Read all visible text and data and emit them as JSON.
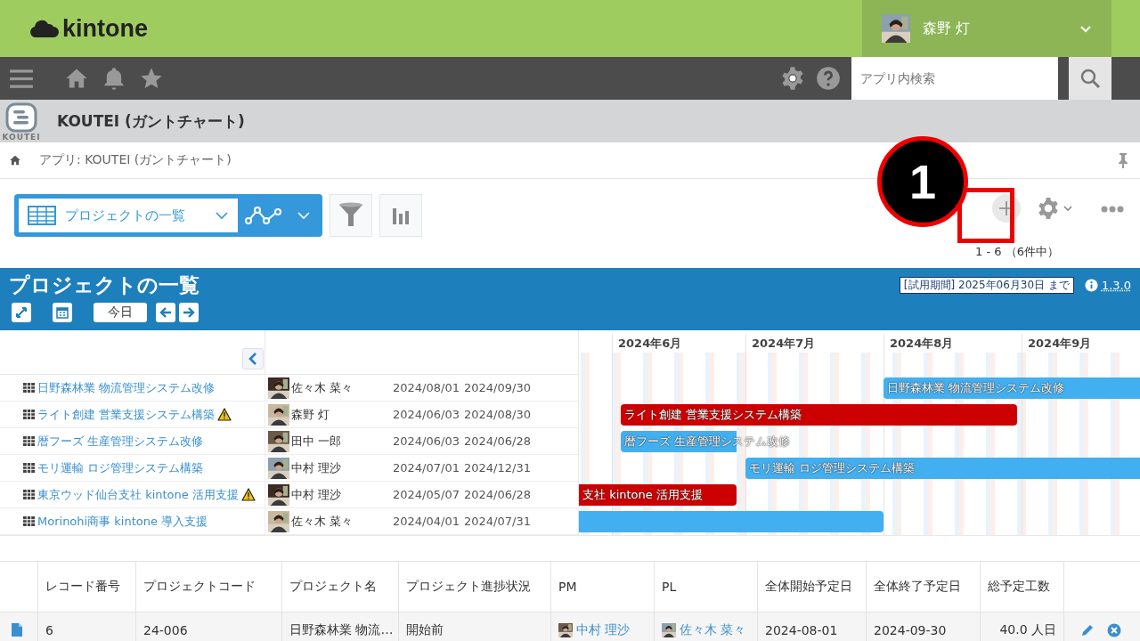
{
  "header": {
    "logo": "kintone",
    "user": {
      "name": "森野 灯"
    }
  },
  "search": {
    "placeholder": "アプリ内検索"
  },
  "app": {
    "icon_caption": "KOUTEI",
    "title": "KOUTEI (ガントチャート)"
  },
  "breadcrumb": {
    "path": "アプリ: KOUTEI (ガントチャート)"
  },
  "toolbar": {
    "view": "プロジェクトの一覧",
    "record_range": "1 - 6 （6件中）",
    "annotation": "1"
  },
  "gantt": {
    "title": "プロジェクトの一覧",
    "trial": "[試用期間] 2025年06月30日 まで",
    "version": "1.3.0",
    "today_button": "今日",
    "months": [
      "2024年6月",
      "2024年7月",
      "2024年8月",
      "2024年9月"
    ],
    "rows": [
      {
        "name": "日野森林業 物流管理システム改修",
        "warning": false,
        "person": "佐々木 菜々",
        "start": "2024/08/01",
        "end": "2024/09/30",
        "bar": {
          "label": "日野森林業 物流管理システム改修",
          "color": "#42aff0"
        }
      },
      {
        "name": "ライト創建 営業支援システム構築",
        "warning": true,
        "person": "森野 灯",
        "start": "2024/06/03",
        "end": "2024/08/30",
        "bar": {
          "label": "ライト創建 営業支援システム構築",
          "color": "#cc0000"
        }
      },
      {
        "name": "暦フーズ 生産管理システム改修",
        "warning": false,
        "person": "田中 一郎",
        "start": "2024/06/03",
        "end": "2024/06/28",
        "bar": {
          "label": "暦フーズ 生産管理システム改修",
          "color": "#42aff0"
        }
      },
      {
        "name": "モリ運輸 ロジ管理システム構築",
        "warning": false,
        "person": "中村 理沙",
        "start": "2024/07/01",
        "end": "2024/12/31",
        "bar": {
          "label": "モリ運輸 ロジ管理システム構築",
          "color": "#42aff0"
        }
      },
      {
        "name": "東京ウッド仙台支社 kintone 活用支援",
        "warning": true,
        "person": "中村 理沙",
        "start": "2024/05/07",
        "end": "2024/06/28",
        "bar": {
          "label": "支社 kintone 活用支援",
          "color": "#cc0000"
        }
      },
      {
        "name": "Morinohi商事 kintone 導入支援",
        "warning": false,
        "person": "佐々木 菜々",
        "start": "2024/04/01",
        "end": "2024/07/31",
        "bar": {
          "color": "#42aff0"
        }
      }
    ]
  },
  "table": {
    "columns": [
      "レコード番号",
      "プロジェクトコード",
      "プロジェクト名",
      "プロジェクト進捗状況",
      "PM",
      "PL",
      "全体開始予定日",
      "全体終了予定日",
      "総予定工数"
    ],
    "rows": [
      {
        "cells": [
          "6",
          "24-006",
          "日野森林業 物流…",
          "開始前",
          "中村 理沙",
          "佐々木 菜々",
          "2024-08-01",
          "2024-09-30",
          "40.0 人日"
        ]
      }
    ]
  }
}
